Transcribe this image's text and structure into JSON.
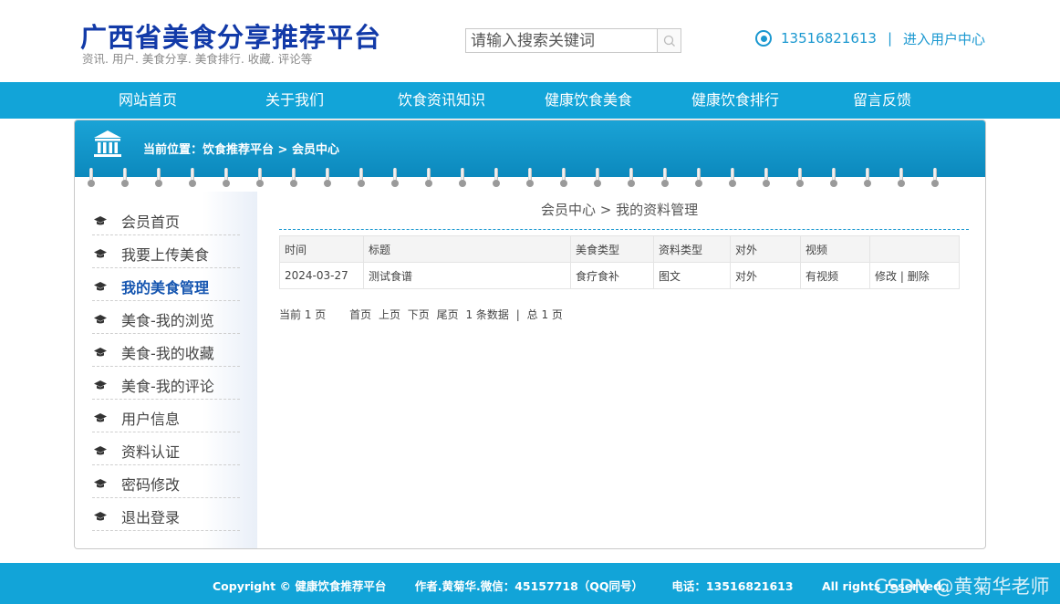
{
  "header": {
    "title": "广西省美食分享推荐平台",
    "subtitle": "资讯. 用户. 美食分享. 美食排行. 收藏. 评论等",
    "search_placeholder": "请输入搜索关键词",
    "phone": "13516821613",
    "separator": "|",
    "user_center": "进入用户中心"
  },
  "nav": {
    "items": [
      "网站首页",
      "关于我们",
      "饮食资讯知识",
      "健康饮食美食",
      "健康饮食排行",
      "留言反馈"
    ]
  },
  "panel": {
    "breadcrumb": "当前位置：饮食推荐平台 > 会员中心"
  },
  "sidebar": {
    "active_index": 2,
    "items": [
      "会员首页",
      "我要上传美食",
      "我的美食管理",
      "美食-我的浏览",
      "美食-我的收藏",
      "美食-我的评论",
      "用户信息",
      "资料认证",
      "密码修改",
      "退出登录"
    ]
  },
  "content": {
    "title": "会员中心 > 我的资料管理",
    "table": {
      "headers": [
        "时间",
        "标题",
        "美食类型",
        "资料类型",
        "对外",
        "视频",
        ""
      ],
      "rows": [
        {
          "time": "2024-03-27",
          "title": "测试食谱",
          "food_type": "食疗食补",
          "data_type": "图文",
          "public": "对外",
          "video": "有视频",
          "edit": "修改",
          "divider": "|",
          "delete": "删除"
        }
      ]
    },
    "pager": {
      "current": "当前 1 页",
      "first": "首页",
      "prev": "上页",
      "next": "下页",
      "last": "尾页",
      "count": "1 条数据",
      "divider": "|",
      "total": "总 1 页"
    }
  },
  "footer": {
    "copyright": "Copyright © 健康饮食推荐平台",
    "author": "作者.黄菊华.微信：45157718（QQ同号）",
    "phone": "电话：13516821613",
    "rights": "All rights reserved.",
    "watermark": "CSDN @黄菊华老师"
  },
  "colors": {
    "brand_title": "#123aa8",
    "accent": "#12a4d8",
    "link": "#1a98d0",
    "active_menu": "#1656b0"
  },
  "icons": {
    "search": "search-icon",
    "location": "target-icon",
    "panel": "bank-icon",
    "menu_bullet": "graduation-cap-icon"
  }
}
